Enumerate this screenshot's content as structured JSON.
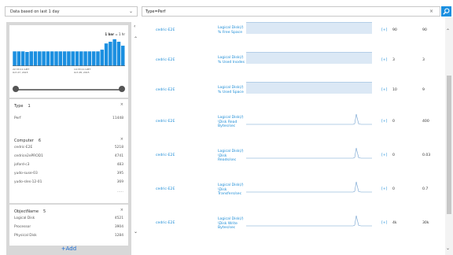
{
  "timeRange": {
    "label": "Data based on last 1 day",
    "chevron": "chevron-down-icon"
  },
  "search": {
    "query": "Type=Perf",
    "clear": "×",
    "button_icon": "search-icon"
  },
  "histogram": {
    "interval_bold": "1 bar",
    "interval_rest": " = 1 hr",
    "start_time": "22:33:11 GMT",
    "start_date": "Oct 27, 2015",
    "end_time": "14:33:11 GMT",
    "end_date": "Oct 28, 2015",
    "bar_color": "#1b8fe0",
    "bars": [
      0.52,
      0.52,
      0.52,
      0.5,
      0.52,
      0.52,
      0.52,
      0.52,
      0.52,
      0.52,
      0.52,
      0.52,
      0.52,
      0.52,
      0.52,
      0.52,
      0.52,
      0.52,
      0.52,
      0.52,
      0.52,
      0.58,
      0.8,
      0.86,
      0.95,
      0.86,
      0.72
    ]
  },
  "facets": {
    "type": {
      "name": "Type",
      "count": "1",
      "rows": [
        {
          "label": "Perf",
          "value": "11448"
        }
      ]
    },
    "computer": {
      "name": "Computer",
      "count": "6",
      "rows": [
        {
          "label": "cedric-E2E",
          "value": "5218"
        },
        {
          "label": "cedrice2ePROD1",
          "value": "4741"
        },
        {
          "label": "joford-c3",
          "value": "483"
        },
        {
          "label": "yudo-suse-03",
          "value": "395"
        },
        {
          "label": "yudo-sles-12-01",
          "value": "369"
        }
      ],
      "more": "....."
    },
    "object": {
      "name": "ObjectName",
      "count": "5",
      "rows": [
        {
          "label": "Logical Disk",
          "value": "4521"
        },
        {
          "label": "Processor",
          "value": "3904"
        },
        {
          "label": "Physical Disk",
          "value": "1284"
        }
      ]
    }
  },
  "add_label": "+Add",
  "results": [
    {
      "computer": "cedric-E2E",
      "counter": [
        "Logical Disk(/)",
        "% Free Space"
      ],
      "plus": "[+]",
      "value": "90",
      "max": "90",
      "spark": "flat_high"
    },
    {
      "computer": "cedric-E2E",
      "counter": [
        "Logical Disk(/)",
        "% Used Inodes"
      ],
      "plus": "[+]",
      "value": "3",
      "max": "3",
      "spark": "flat_high"
    },
    {
      "computer": "cedric-E2E",
      "counter": [
        "Logical Disk(/)",
        "% Used Space"
      ],
      "plus": "[+]",
      "value": "10",
      "max": "9",
      "spark": "flat_high"
    },
    {
      "computer": "cedric-E2E",
      "counter": [
        "Logical Disk(/)",
        "\\Disk Read",
        "Bytes/sec"
      ],
      "plus": "[+]",
      "value": "0",
      "max": "400",
      "spark": "spike"
    },
    {
      "computer": "cedric-E2E",
      "counter": [
        "Logical Disk(/)",
        "\\Disk",
        "Reads/sec"
      ],
      "plus": "[+]",
      "value": "0",
      "max": "0.03",
      "spark": "spike"
    },
    {
      "computer": "cedric-E2E",
      "counter": [
        "Logical Disk(/)",
        "\\Disk",
        "Transfers/sec"
      ],
      "plus": "[+]",
      "value": "0",
      "max": "0.7",
      "spark": "spike"
    },
    {
      "computer": "cedric-E2E",
      "counter": [
        "Logical Disk(/)",
        "\\Disk Write",
        "Bytes/sec"
      ],
      "plus": "[+]",
      "value": "4k",
      "max": "30k",
      "spark": "spike"
    }
  ]
}
